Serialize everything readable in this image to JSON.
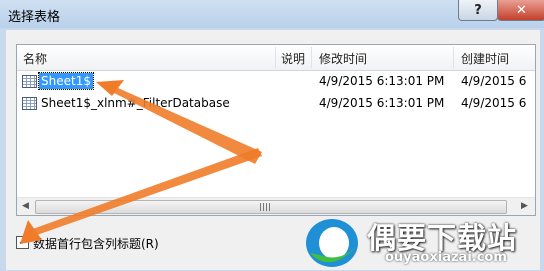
{
  "window": {
    "title": "选择表格",
    "help_label": "?",
    "close_label": "✕"
  },
  "table": {
    "columns": [
      "名称",
      "说明",
      "修改时间",
      "创建时间"
    ],
    "rows": [
      {
        "name": "Sheet1$",
        "desc": "",
        "modified": "4/9/2015 6:13:01 PM",
        "created": "4/9/2015 6",
        "selected": true
      },
      {
        "name": "Sheet1$_xlnm#_FilterDatabase",
        "desc": "",
        "modified": "4/9/2015 6:13:01 PM",
        "created": "4/9/2015 6",
        "selected": false
      }
    ]
  },
  "scrollbar": {
    "left_arrow": "◀",
    "right_arrow": "▶"
  },
  "options": {
    "first_row_header_label": "数据首行包含列标题(R)",
    "first_row_header_checked": true,
    "check_mark": "✓"
  },
  "watermark": {
    "text": "偶要下载站",
    "url": "ouyaoxiazai.com"
  },
  "colors": {
    "selection": "#3399ff",
    "arrow": "#f07c2a"
  }
}
